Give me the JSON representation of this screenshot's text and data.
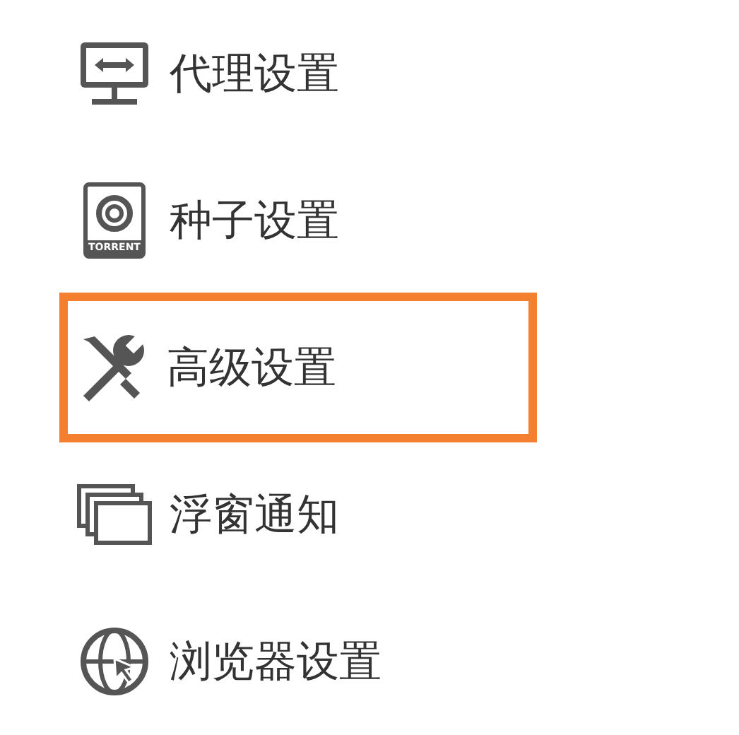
{
  "settings_menu": [
    {
      "kind": "proxy",
      "label": "代理设置",
      "highlighted": false
    },
    {
      "kind": "torrent",
      "label": "种子设置",
      "icon_text": "TORRENT",
      "highlighted": false
    },
    {
      "kind": "tools",
      "label": "高级设置",
      "highlighted": true
    },
    {
      "kind": "windows",
      "label": "浮窗通知",
      "highlighted": false
    },
    {
      "kind": "globe",
      "label": "浏览器设置",
      "highlighted": false
    }
  ]
}
